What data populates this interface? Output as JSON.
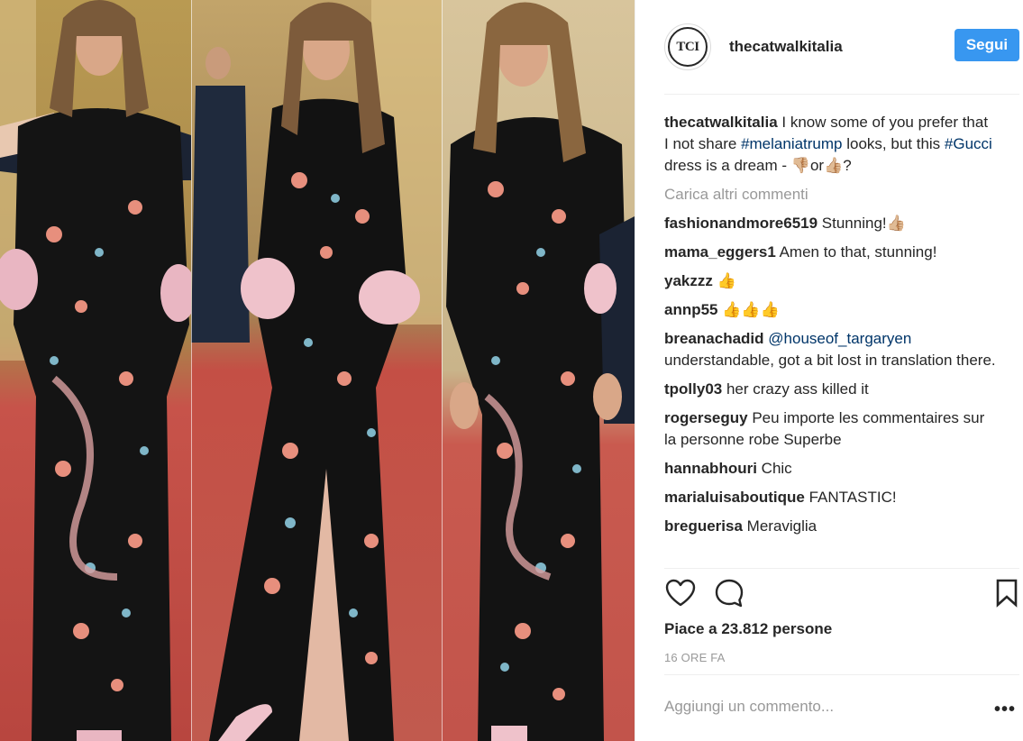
{
  "post": {
    "image_alt": "Three photos of a woman in a black embroidered floral gown",
    "account": {
      "username": "thecatwalkitalia",
      "avatar_text": "TCI",
      "follow_label": "Segui"
    },
    "caption": {
      "username": "thecatwalkitalia",
      "text_1": " I know some of you prefer that I not share ",
      "hashtag_1": "#melaniatrump",
      "text_2": " looks, but this ",
      "hashtag_2": "#Gucci",
      "text_3": " dress is a dream - ",
      "emoji_1": "👎🏼",
      "text_4": "or",
      "emoji_2": "👍🏼",
      "text_5": "?"
    },
    "load_more_label": "Carica altri commenti",
    "comments": [
      {
        "username": "fashionandmore6519",
        "text": " Stunning!",
        "emoji": "👍🏼"
      },
      {
        "username": "mama_eggers1",
        "text": " Amen to that, stunning!"
      },
      {
        "username": "yakzzz",
        "text": " ",
        "emoji": "👍"
      },
      {
        "username": "annp55",
        "text": " ",
        "emoji": "👍👍👍"
      },
      {
        "username": "breanachadid",
        "mention": "@houseof_targaryen",
        "text": " understandable, got a bit lost in translation there."
      },
      {
        "username": "tpolly03",
        "text": " her crazy ass killed it"
      },
      {
        "username": "rogerseguy",
        "text": " Peu importe les commentaires sur la personne robe Superbe"
      },
      {
        "username": "hannabhouri",
        "text": " Chic"
      },
      {
        "username": "marialuisaboutique",
        "text": " FANTASTIC!"
      },
      {
        "username": "breguerisa",
        "text": " Meraviglia"
      }
    ],
    "actions": {
      "like_icon": "heart-icon",
      "comment_icon": "comment-bubble-icon",
      "save_icon": "bookmark-icon"
    },
    "likes_label": "Piace a 23.812 persone",
    "time_label": "16 ORE FA",
    "add_comment_placeholder": "Aggiungi un commento...",
    "more_label": "•••"
  },
  "colors": {
    "accent": "#3897f0",
    "link": "#003569",
    "muted": "#999999",
    "text": "#262626"
  }
}
